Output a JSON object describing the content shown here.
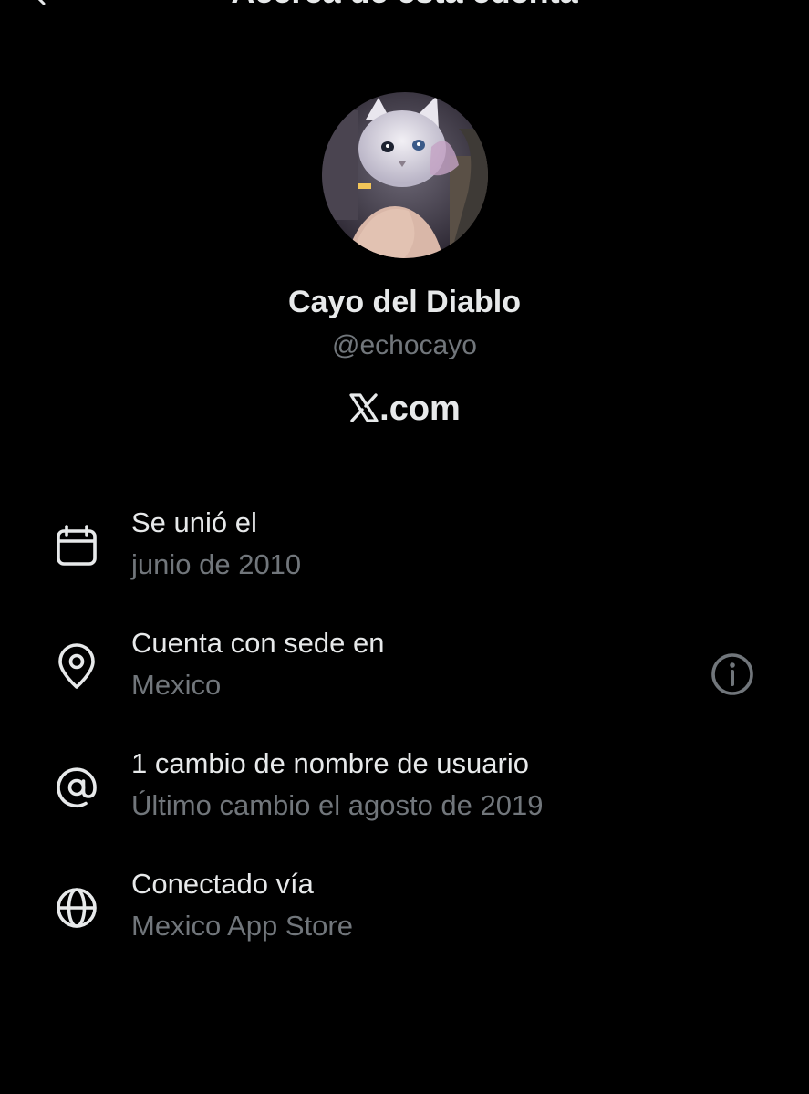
{
  "header": {
    "title": "Acerca de esta cuenta"
  },
  "profile": {
    "display_name": "Cayo del Diablo",
    "handle": "@echocayo",
    "platform_suffix": ".com"
  },
  "details": [
    {
      "icon": "calendar-icon",
      "label": "Se unió el",
      "value": "junio de 2010"
    },
    {
      "icon": "location-pin-icon",
      "label": "Cuenta con sede en",
      "value": "Mexico",
      "has_info": true
    },
    {
      "icon": "at-sign-icon",
      "label": "1 cambio de nombre de usuario",
      "value": "Último cambio el agosto de 2019"
    },
    {
      "icon": "globe-icon",
      "label": "Conectado vía",
      "value": "Mexico App Store"
    }
  ],
  "colors": {
    "background": "#000000",
    "primary_text": "#e7e9ea",
    "secondary_text": "#71767b"
  }
}
